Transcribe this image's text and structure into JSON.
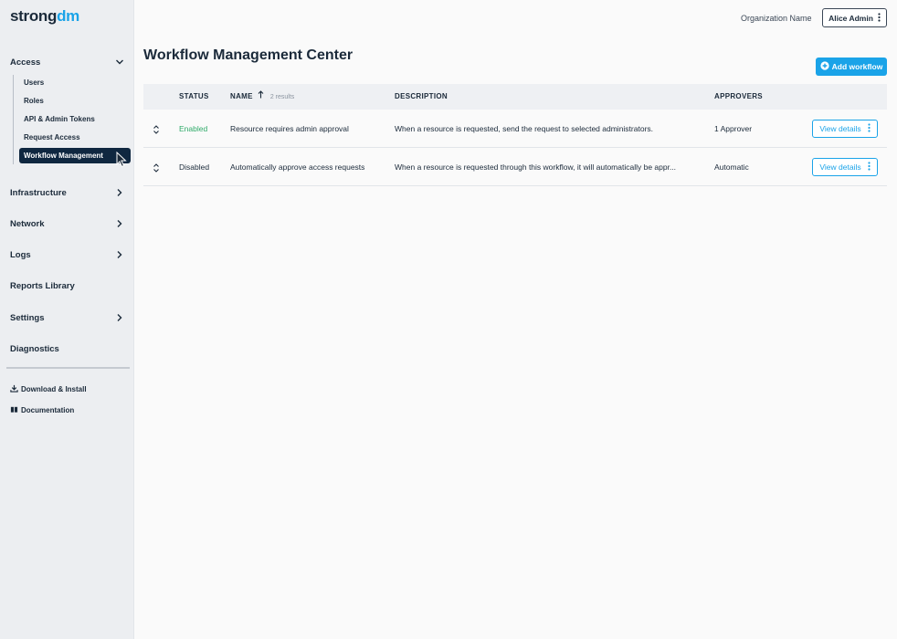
{
  "brand": {
    "logo_main": "strong",
    "logo_accent": "dm"
  },
  "header": {
    "org_name": "Organization Name",
    "user_button": "Alice Admin",
    "page_title": "Workflow Management Center",
    "add_button": "Add workflow"
  },
  "sidebar": {
    "access": "Access",
    "sub_items": [
      "Users",
      "Roles",
      "API & Admin Tokens",
      "Request Access",
      "Workflow Management"
    ],
    "active_sub_item": "Workflow Management",
    "sections": [
      "Infrastructure",
      "Network",
      "Logs",
      "Reports Library",
      "Settings",
      "Diagnostics"
    ],
    "footer": [
      "Download & Install",
      "Documentation"
    ]
  },
  "table": {
    "headers": {
      "status": "STATUS",
      "name": "NAME",
      "name_count": "2 results",
      "description": "DESCRIPTION",
      "approvers": "APPROVERS"
    },
    "rows": [
      {
        "status": "Enabled",
        "name": "Resource requires admin approval",
        "description": "When a resource is requested, send the request to selected administrators.",
        "approvers": "1 Approver",
        "action": "View details"
      },
      {
        "status": "Disabled",
        "name": "Automatically approve access requests",
        "description": "When a resource is requested through this workflow, it will automatically be appr...",
        "approvers": "Automatic",
        "action": "View details"
      }
    ]
  },
  "colors": {
    "accent": "#1aa3e8",
    "enabled": "#2eaa68",
    "active_nav": "#0f2740",
    "sidebar_bg": "#eceef1"
  },
  "icons": {
    "expand_row": "chevron-up-down-icon",
    "more": "kebab-menu-icon",
    "add": "plus-circle-icon",
    "download": "download-icon",
    "docs": "book-icon",
    "sort": "arrow-up-icon"
  }
}
